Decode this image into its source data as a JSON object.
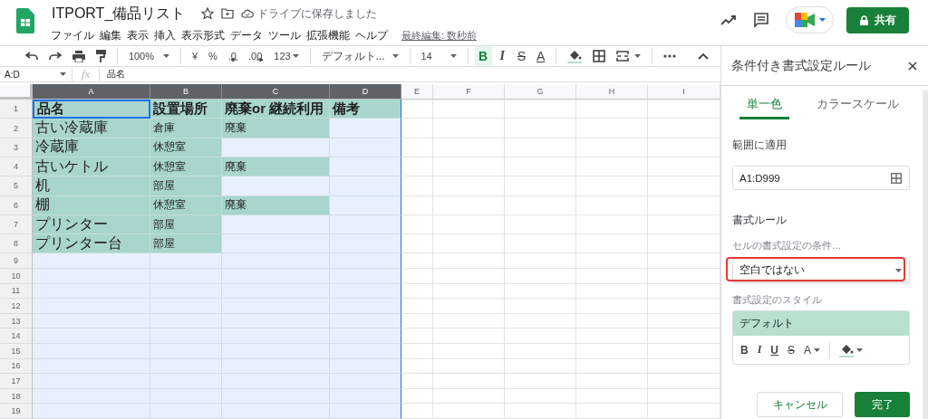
{
  "app": {
    "title": "ITPORT_備品リスト",
    "save_status": "ドライブに保存しました",
    "menus": [
      "ファイル",
      "編集",
      "表示",
      "挿入",
      "表示形式",
      "データ",
      "ツール",
      "拡張機能",
      "ヘルプ"
    ],
    "last_edit": "最終編集: 数秒前",
    "share_button": "共有"
  },
  "toolbar": {
    "zoom": "100%",
    "number_formats": [
      {
        "label": "¥",
        "kind": "plain"
      },
      {
        "label": "%",
        "kind": "plain"
      },
      {
        "label": ".0",
        "kind": "decrease"
      },
      {
        "label": ".00",
        "kind": "increase"
      },
      {
        "label": "123",
        "kind": "menu"
      }
    ],
    "font": "デフォルト...",
    "font_size": "14",
    "format_buttons": [
      {
        "label": "B",
        "kind": "bold",
        "on": true
      },
      {
        "label": "I",
        "kind": "italic",
        "on": false
      },
      {
        "label": "S",
        "kind": "strike",
        "on": false
      },
      {
        "label": "A",
        "kind": "color",
        "on": false
      }
    ]
  },
  "formula_bar": {
    "name_box": "A:D",
    "fx": "fx",
    "value": "品名"
  },
  "grid": {
    "columns": [
      {
        "label": "A",
        "selected": true
      },
      {
        "label": "B",
        "selected": true
      },
      {
        "label": "C",
        "selected": true
      },
      {
        "label": "D",
        "selected": true
      },
      {
        "label": "E",
        "selected": false
      },
      {
        "label": "F",
        "selected": false
      },
      {
        "label": "G",
        "selected": false
      },
      {
        "label": "H",
        "selected": false
      },
      {
        "label": "I",
        "selected": false
      }
    ],
    "rows": [
      {
        "number": "1",
        "cells": [
          {
            "text": "品名",
            "highlighted": true,
            "active": true
          },
          {
            "text": "設置場所",
            "highlighted": true,
            "active": false
          },
          {
            "text": "廃棄or 継続利用",
            "highlighted": true,
            "active": false
          },
          {
            "text": "備考",
            "highlighted": true,
            "active": false
          }
        ]
      },
      {
        "number": "2",
        "cells": [
          {
            "text": "古い冷蔵庫",
            "highlighted": true,
            "active": false
          },
          {
            "text": "倉庫",
            "highlighted": true,
            "active": false
          },
          {
            "text": "廃棄",
            "highlighted": true,
            "active": false
          },
          {
            "highlighted": false,
            "active": false
          }
        ]
      },
      {
        "number": "3",
        "cells": [
          {
            "text": "冷蔵庫",
            "highlighted": true,
            "active": false
          },
          {
            "text": "休憩室",
            "highlighted": true,
            "active": false
          },
          {
            "highlighted": false,
            "active": false
          },
          {
            "highlighted": false,
            "active": false
          }
        ]
      },
      {
        "number": "4",
        "cells": [
          {
            "text": "古いケトル",
            "highlighted": true,
            "active": false
          },
          {
            "text": "休憩室",
            "highlighted": true,
            "active": false
          },
          {
            "text": "廃棄",
            "highlighted": true,
            "active": false
          },
          {
            "highlighted": false,
            "active": false
          }
        ]
      },
      {
        "number": "5",
        "cells": [
          {
            "text": "机",
            "highlighted": true,
            "active": false
          },
          {
            "text": "部屋",
            "highlighted": true,
            "active": false
          },
          {
            "highlighted": false,
            "active": false
          },
          {
            "highlighted": false,
            "active": false
          }
        ]
      },
      {
        "number": "6",
        "cells": [
          {
            "text": "棚",
            "highlighted": true,
            "active": false
          },
          {
            "text": "休憩室",
            "highlighted": true,
            "active": false
          },
          {
            "text": "廃棄",
            "highlighted": true,
            "active": false
          },
          {
            "highlighted": false,
            "active": false
          }
        ]
      },
      {
        "number": "7",
        "cells": [
          {
            "text": "プリンター",
            "highlighted": true,
            "active": false
          },
          {
            "text": "部屋",
            "highlighted": true,
            "active": false
          },
          {
            "highlighted": false,
            "active": false
          },
          {
            "highlighted": false,
            "active": false
          }
        ]
      },
      {
        "number": "8",
        "cells": [
          {
            "text": "プリンター台",
            "highlighted": true,
            "active": false
          },
          {
            "text": "部屋",
            "highlighted": true,
            "active": false
          },
          {
            "highlighted": false,
            "active": false
          },
          {
            "highlighted": false,
            "active": false
          }
        ]
      },
      {
        "number": "9"
      },
      {
        "number": "10"
      },
      {
        "number": "11"
      },
      {
        "number": "12"
      },
      {
        "number": "13"
      },
      {
        "number": "14"
      },
      {
        "number": "15"
      },
      {
        "number": "16"
      },
      {
        "number": "17"
      },
      {
        "number": "18"
      },
      {
        "number": "19"
      }
    ]
  },
  "panel": {
    "title": "条件付き書式設定ルール",
    "tabs": [
      {
        "label": "単一色",
        "selected": true
      },
      {
        "label": "カラースケール",
        "selected": false
      }
    ],
    "range_label": "範囲に適用",
    "range_value": "A1:D999",
    "rules_label": "書式ルール",
    "condition_label": "セルの書式設定の条件…",
    "condition_value": "空白ではない",
    "condition_highlighted": true,
    "style_label": "書式設定のスタイル",
    "style_preview": "デフォルト",
    "style_buttons": [
      {
        "label": "B",
        "kind": "bold"
      },
      {
        "label": "I",
        "kind": "italic"
      },
      {
        "label": "U",
        "kind": "underline"
      },
      {
        "label": "S",
        "kind": "strike"
      },
      {
        "label": "A",
        "kind": "color"
      },
      {
        "kind": "fill"
      }
    ],
    "buttons": [
      {
        "label": "キャンセル",
        "kind": "secondary"
      },
      {
        "label": "完了",
        "kind": "primary"
      }
    ]
  }
}
